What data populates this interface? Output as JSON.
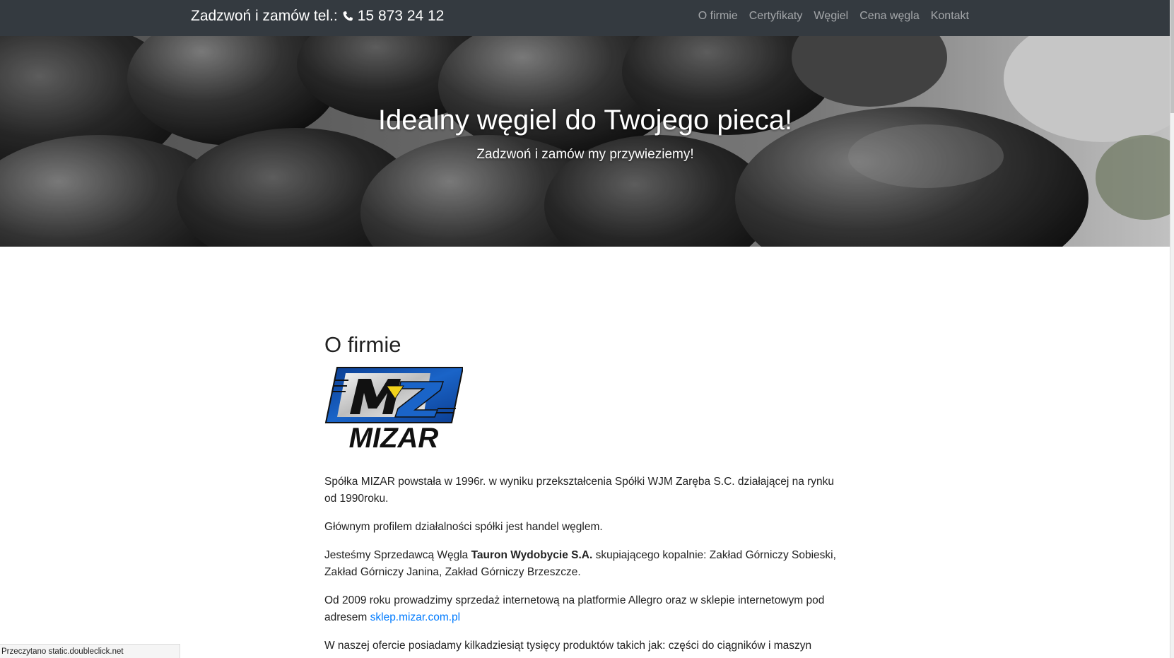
{
  "navbar": {
    "brand_text": "Zadzwoń i zamów tel.:",
    "phone": "15 873 24 12",
    "phone_icon": "phone-icon",
    "links": [
      "O firmie",
      "Certyfikaty",
      "Węgiel",
      "Cena węgla",
      "Kontakt"
    ]
  },
  "hero": {
    "title": "Idealny węgiel do Twojego pieca!",
    "subtitle": "Zadzwoń i zamów my przywieziemy!"
  },
  "about": {
    "title": "O firmie",
    "logo_text": "MIZAR",
    "p1": "Spółka MIZAR powstała w 1996r. w wyniku przekształcenia Spółki WJM Zaręba S.C. działającej na rynku od 1990roku.",
    "p2": "Głównym profilem działalności spółki jest handel węglem.",
    "p3_pre": "Jesteśmy Sprzedawcą Węgla ",
    "p3_bold": "Tauron Wydobycie S.A.",
    "p3_post": " skupiającego kopalnie: Zakład Górniczy Sobieski, Zakład Górniczy Janina, Zakład Górniczy Brzeszcze.",
    "p4_pre": "Od 2009 roku prowadzimy sprzedaż internetową na platformie Allegro oraz w sklepie internetowym pod adresem ",
    "p4_link": "sklep.mizar.com.pl",
    "p5": "W naszej ofercie posiadamy kilkadziesiąt tysięcy produktów takich jak: części do ciągników i maszyn"
  },
  "status_bar": {
    "text": "Przeczytano static.doubleclick.net"
  },
  "colors": {
    "navbar_bg": "#343a40",
    "link": "#007bff",
    "logo_blue": "#1a64c8",
    "logo_yellow": "#f2d21a"
  }
}
